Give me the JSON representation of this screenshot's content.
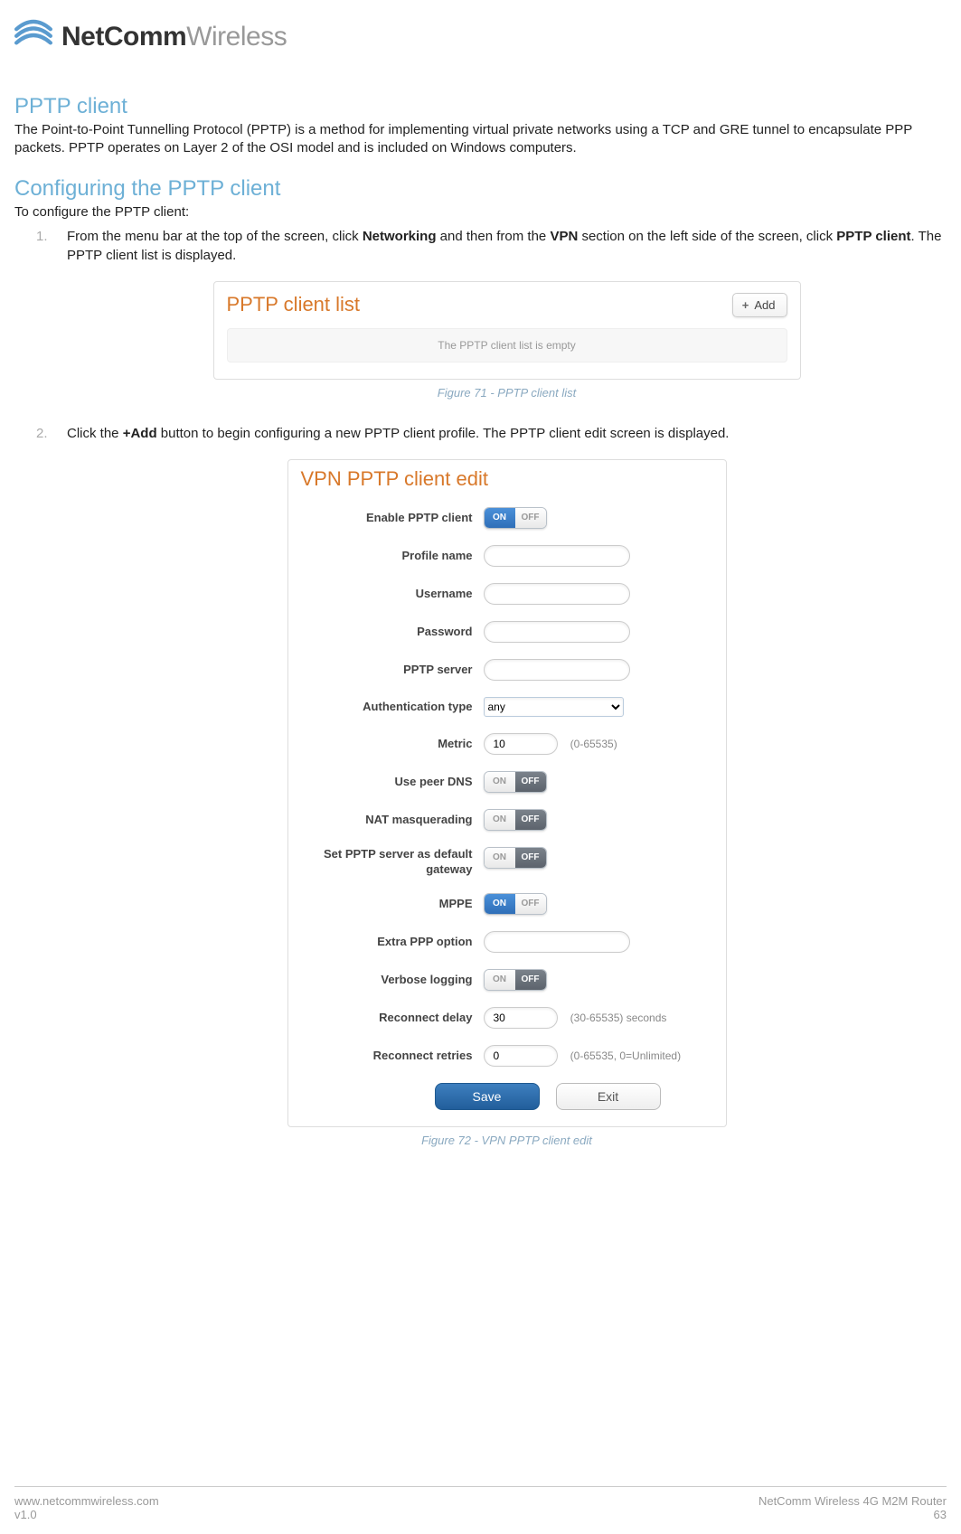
{
  "brand": {
    "bold": "NetComm",
    "light": "Wireless"
  },
  "sections": {
    "pptp_client_heading": "PPTP client",
    "pptp_client_body": "The Point-to-Point Tunnelling Protocol (PPTP) is a method for implementing virtual private networks using a TCP and GRE tunnel to encapsulate PPP packets. PPTP operates on Layer 2 of the OSI model and is included on Windows computers.",
    "config_heading": "Configuring the PPTP client",
    "config_intro": "To configure the PPTP client:"
  },
  "steps": {
    "s1_pre": "From the menu bar at the top of the screen, click ",
    "s1_b1": "Networking",
    "s1_mid": " and then from the ",
    "s1_b2": "VPN",
    "s1_mid2": " section on the left side of the screen, click ",
    "s1_b3": "PPTP client",
    "s1_post": ". The PPTP client list is displayed.",
    "s2_pre": "Click the ",
    "s2_b1": "+Add",
    "s2_post": " button to begin configuring a new PPTP client profile. The PPTP client edit screen is displayed."
  },
  "fig71": {
    "title": "PPTP client list",
    "add_label": "Add",
    "empty": "The PPTP client list is empty",
    "caption": "Figure 71 - PPTP client list"
  },
  "fig72": {
    "title": "VPN PPTP client edit",
    "caption": "Figure 72 - VPN PPTP client edit",
    "labels": {
      "enable": "Enable PPTP client",
      "profile": "Profile name",
      "username": "Username",
      "password": "Password",
      "server": "PPTP server",
      "auth": "Authentication type",
      "metric": "Metric",
      "peer_dns": "Use peer DNS",
      "nat": "NAT masquerading",
      "default_gw": "Set PPTP server as default gateway",
      "mppe": "MPPE",
      "extra_ppp": "Extra PPP option",
      "verbose": "Verbose logging",
      "reconnect_delay": "Reconnect delay",
      "reconnect_retries": "Reconnect retries"
    },
    "values": {
      "auth": "any",
      "metric": "10",
      "reconnect_delay": "30",
      "reconnect_retries": "0"
    },
    "hints": {
      "metric": "(0-65535)",
      "reconnect_delay": "(30-65535) seconds",
      "reconnect_retries": "(0-65535, 0=Unlimited)"
    },
    "toggle": {
      "on": "ON",
      "off": "OFF"
    },
    "buttons": {
      "save": "Save",
      "exit": "Exit"
    }
  },
  "footer": {
    "url": "www.netcommwireless.com",
    "version": "v1.0",
    "product": "NetComm Wireless 4G M2M Router",
    "page": "63"
  }
}
